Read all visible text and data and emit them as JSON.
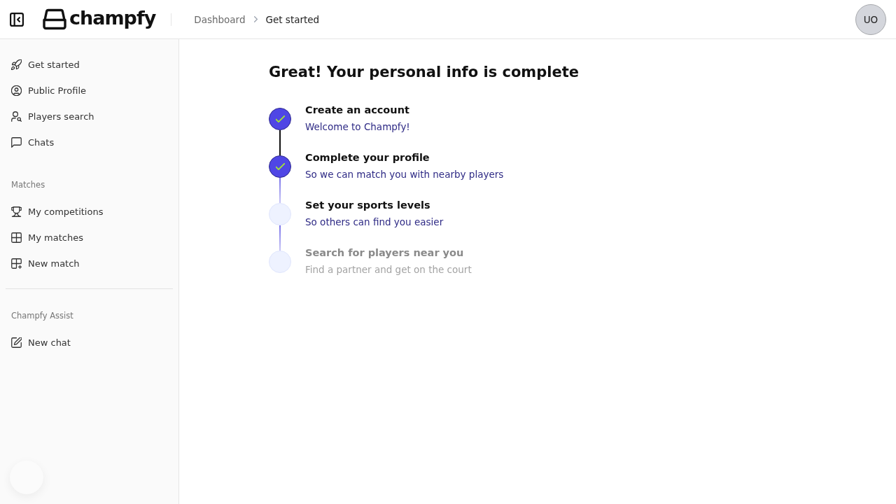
{
  "header": {
    "logo_text": "champfy",
    "breadcrumb": [
      {
        "label": "Dashboard",
        "current": false
      },
      {
        "label": "Get started",
        "current": true
      }
    ],
    "avatar": {
      "initials": "UO"
    }
  },
  "sidebar": {
    "nav": [
      {
        "label": "Get started"
      },
      {
        "label": "Public Profile"
      },
      {
        "label": "Players search"
      },
      {
        "label": "Chats"
      }
    ],
    "sections": [
      {
        "heading": "Matches",
        "items": [
          {
            "label": "My competitions"
          },
          {
            "label": "My matches"
          },
          {
            "label": "New match"
          }
        ]
      },
      {
        "heading": "Champfy Assist",
        "items": [
          {
            "label": "New chat"
          }
        ]
      }
    ]
  },
  "main": {
    "title": "Great! Your personal info is complete",
    "steps": [
      {
        "title": "Create an account",
        "subtitle": "Welcome to Champfy!",
        "done": true,
        "disabled": false
      },
      {
        "title": "Complete your profile",
        "subtitle": "So we can match you with nearby players",
        "done": true,
        "disabled": false
      },
      {
        "title": "Set your sports levels",
        "subtitle": "So others can find you easier",
        "done": false,
        "disabled": false
      },
      {
        "title": "Search for players near you",
        "subtitle": "Find a partner and get on the court",
        "done": false,
        "disabled": true
      }
    ]
  }
}
